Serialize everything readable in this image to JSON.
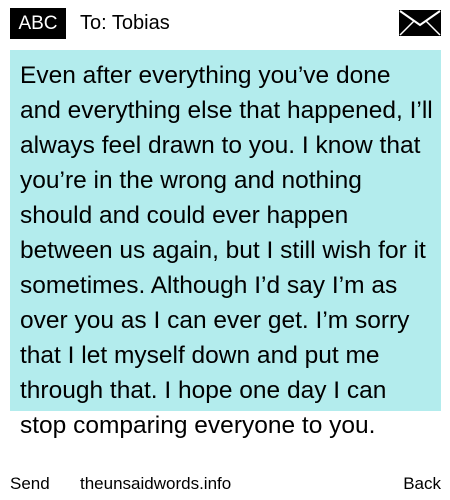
{
  "header": {
    "mode_badge": "ABC",
    "recipient_line": "To: Tobias",
    "envelope_icon": "envelope-icon"
  },
  "message": {
    "body": "Even after everything you’ve done and everything else that happened, I’ll always feel drawn to you. I know that you’re in the wrong and nothing should and could ever happen between us again, but I still wish for it sometimes. Although I’d say I’m as over you as I can ever get. I’m sorry that I let myself down and put me through that. I hope one day I can stop comparing everyone to you.",
    "highlight_color": "#b3eced"
  },
  "softkeys": {
    "left": "Send",
    "center": "theunsaidwords.info",
    "right": "Back"
  }
}
